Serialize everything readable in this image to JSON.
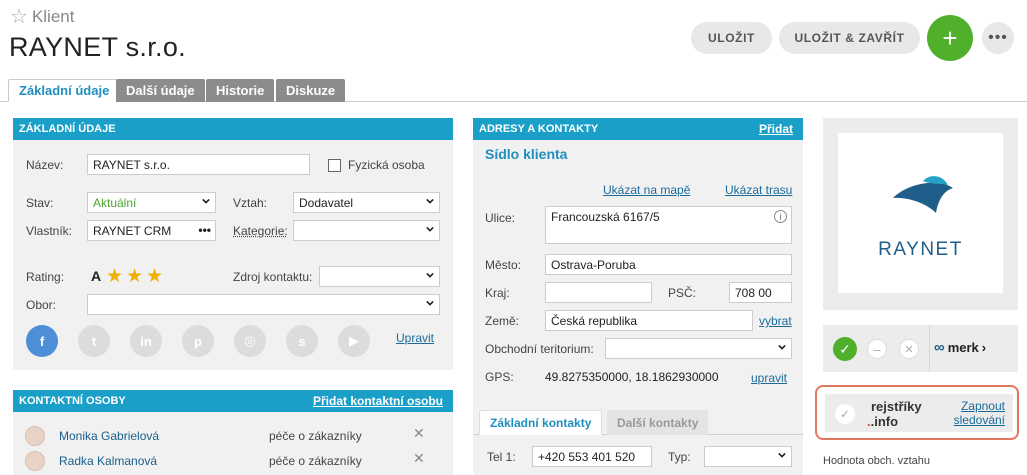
{
  "header": {
    "entity_type": "Klient",
    "title": "RAYNET s.r.o.",
    "save_label": "ULOŽIT",
    "save_close_label": "ULOŽIT & ZAVŘÍT",
    "add_label": "+",
    "more_label": "•••"
  },
  "tabs": [
    {
      "label": "Základní údaje",
      "active": true
    },
    {
      "label": "Další údaje"
    },
    {
      "label": "Historie"
    },
    {
      "label": "Diskuze"
    }
  ],
  "basic": {
    "heading": "ZÁKLADNÍ ÚDAJE",
    "name_label": "Název:",
    "name_value": "RAYNET s.r.o.",
    "person_label": "Fyzická osoba",
    "status_label": "Stav:",
    "status_value": "Aktuální",
    "relation_label": "Vztah:",
    "relation_value": "Dodavatel",
    "owner_label": "Vlastník:",
    "owner_value": "RAYNET CRM",
    "owner_more": "•••",
    "category_label": "Kategorie:",
    "rating_label": "Rating:",
    "rating_value": "A",
    "rating_stars": 3,
    "source_label": "Zdroj kontaktu:",
    "field_label": "Obor:",
    "edit_link": "Upravit",
    "social_icons": [
      "facebook-icon",
      "twitter-icon",
      "linkedin-icon",
      "pinterest-icon",
      "instagram-icon",
      "skype-icon",
      "youtube-icon"
    ]
  },
  "contacts": {
    "heading": "KONTAKTNÍ OSOBY",
    "add_link": "Přidat kontaktní osobu",
    "rows": [
      {
        "name": "Monika Gabrielová",
        "role": "péče o zákazníky"
      },
      {
        "name": "Radka Kalmanová",
        "role": "péče o zákazníky"
      }
    ]
  },
  "address": {
    "heading": "ADRESY A KONTAKTY",
    "add_link": "Přidat",
    "section_title": "Sídlo klienta",
    "show_map": "Ukázat na mapě",
    "show_route": "Ukázat trasu",
    "street_label": "Ulice:",
    "street_value": "Francouzská 6167/5",
    "city_label": "Město:",
    "city_value": "Ostrava-Poruba",
    "region_label": "Kraj:",
    "zip_label": "PSČ:",
    "zip_value": "708 00",
    "country_label": "Země:",
    "country_value": "Česká republika",
    "choose_link": "vybrat",
    "territory_label": "Obchodní teritorium:",
    "gps_label": "GPS:",
    "gps_value": "49.8275350000, 18.1862930000",
    "gps_edit": "upravit",
    "subtab_basic": "Základní kontakty",
    "subtab_other": "Další kontakty",
    "phone_label": "Tel 1:",
    "phone_value": "+420 553 401 520",
    "type_label": "Typ:"
  },
  "side": {
    "logo_text": "RAYNET",
    "merk_label": "merk",
    "rejstriky_line1": "rejstříky",
    "rejstriky_line2": ".info",
    "follow_line1": "Zapnout",
    "follow_line2": "sledování",
    "relation_value_label": "Hodnota obch. vztahu"
  },
  "colors": {
    "accent": "#1aa0c8",
    "green": "#50b02c",
    "highlight_border": "#e07a5f",
    "logo_blue": "#1f5e8a",
    "logo_teal": "#25a3c4"
  }
}
